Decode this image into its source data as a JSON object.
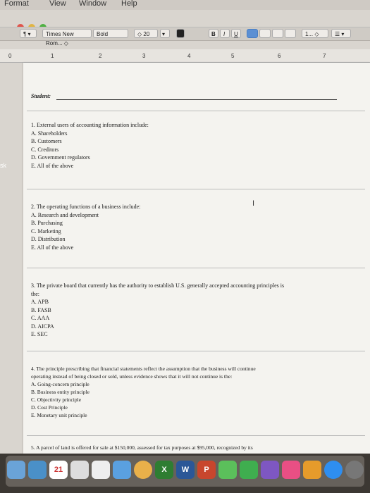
{
  "menubar": {
    "format": "Format",
    "view": "View",
    "window": "Window",
    "help": "Help"
  },
  "toolbar": {
    "paragraph": "¶ ▾",
    "font": "Times New Rom... ◇",
    "weight": "Bold",
    "size": "◇ 20",
    "size_arrow": "▾",
    "bold": "B",
    "italic": "I",
    "underline": "U",
    "spacing": "1... ◇",
    "list": "☰ ▾"
  },
  "ruler": {
    "ticks": [
      "0",
      "1",
      "2",
      "3",
      "4",
      "5",
      "6",
      "7"
    ]
  },
  "side_text": "sk",
  "document": {
    "student_label": "Student:",
    "questions": [
      {
        "lines": [
          "1. External users of accounting information include:",
          "A. Shareholders",
          "B. Customers",
          "C. Creditors",
          "D. Government regulators",
          "E. All of the above"
        ]
      },
      {
        "lines": [
          "2. The operating functions of a business include:",
          "A. Research and development",
          "B. Purchasing",
          "C. Marketing",
          "D. Distribution",
          "E. All of the above"
        ]
      },
      {
        "lines": [
          "3. The private board that currently has the authority to establish U.S. generally accepted accounting principles is",
          "the:",
          "A. APB",
          "B. FASB",
          "C. AAA",
          "D. AICPA",
          "E. SEC"
        ]
      },
      {
        "lines": [
          "4. The principle prescribing that financial statements reflect the assumption that the business will continue",
          "operating instead of being closed or sold, unless evidence shows that it will not continue is the:",
          "A. Going-concern principle",
          "B. Business entity principle",
          "C. Objectivity principle",
          "D. Cost Principle",
          "E. Monetary unit principle"
        ]
      },
      {
        "lines": [
          "5. A parcel of land is offered for sale at $150,000, assessed for tax purposes at $95,000, recognized by its"
        ]
      }
    ]
  },
  "dock": {
    "calendar_day": "21",
    "word": "W",
    "powerpoint": "P"
  },
  "colors": {
    "page": "#f4f3ef",
    "window": "#d9d5cf",
    "dock": "#3c3833",
    "accent": "#5b8fd3"
  }
}
